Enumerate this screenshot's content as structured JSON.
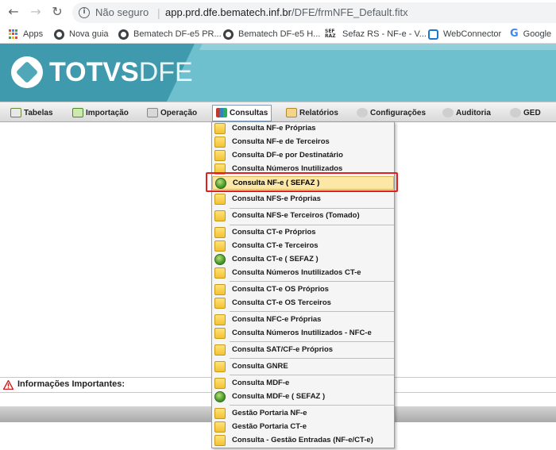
{
  "browser": {
    "back": "←",
    "forward": "→",
    "reload": "↻",
    "security_label": "Não seguro",
    "separator": "|",
    "url_host": "app.prd.dfe.bematech.inf.br",
    "url_path": "/DFE/frmNFE_Default.fitx",
    "bookmarks": [
      {
        "label": "Apps",
        "icon": "apps-icon"
      },
      {
        "label": "Nova guia",
        "icon": "globe-icon"
      },
      {
        "label": "Bematech DF-e5 PR...",
        "icon": "globe-icon"
      },
      {
        "label": "Bematech DF-e5 H...",
        "icon": "globe-icon"
      },
      {
        "label": "Sefaz RS - NF-e - V...",
        "icon": "sefaz-icon"
      },
      {
        "label": "WebConnector",
        "icon": "webconnector-icon"
      },
      {
        "label": "Google",
        "icon": "google-icon"
      }
    ]
  },
  "app": {
    "brand_a": "TOTVS",
    "brand_b": "DFE",
    "brand_color": "#4fa7b8"
  },
  "menu": [
    {
      "label": "Tabelas",
      "icon": "table-icon",
      "active": false
    },
    {
      "label": "Importação",
      "icon": "import-icon",
      "active": false
    },
    {
      "label": "Operação",
      "icon": "operation-icon",
      "active": false
    },
    {
      "label": "Consultas",
      "icon": "query-icon",
      "active": true
    },
    {
      "label": "Relatórios",
      "icon": "report-icon",
      "active": false
    },
    {
      "label": "Configurações",
      "icon": "gear-icon",
      "active": false
    },
    {
      "label": "Auditoria",
      "icon": "gear-icon",
      "active": false
    },
    {
      "label": "GED",
      "icon": "gear-icon",
      "active": false
    }
  ],
  "dropdown": {
    "items": [
      {
        "label": "Consulta NF-e Próprias",
        "icon": "folder"
      },
      {
        "label": "Consulta NF-e de Terceiros",
        "icon": "folder"
      },
      {
        "label": "Consulta DF-e por Destinatário",
        "icon": "folder"
      },
      {
        "label": "Consulta Números Inutilizados",
        "icon": "folder"
      },
      {
        "label": "Consulta NF-e ( SEFAZ )",
        "icon": "globe",
        "highlighted": true
      },
      {
        "label": "Consulta NFS-e Próprias",
        "icon": "folder"
      },
      {
        "label": "Consulta NFS-e Terceiros (Tomado)",
        "icon": "folder"
      },
      {
        "label": "Consulta CT-e Próprios",
        "icon": "folder"
      },
      {
        "label": "Consulta CT-e Terceiros",
        "icon": "folder"
      },
      {
        "label": "Consulta CT-e ( SEFAZ )",
        "icon": "globe"
      },
      {
        "label": "Consulta Números Inutilizados CT-e",
        "icon": "folder"
      },
      {
        "label": "Consulta CT-e OS Próprios",
        "icon": "folder"
      },
      {
        "label": "Consulta CT-e OS Terceiros",
        "icon": "folder"
      },
      {
        "label": "Consulta NFC-e Próprias",
        "icon": "folder"
      },
      {
        "label": "Consulta Números Inutilizados - NFC-e",
        "icon": "folder"
      },
      {
        "label": "Consulta SAT/CF-e Próprios",
        "icon": "folder"
      },
      {
        "label": "Consulta GNRE",
        "icon": "folder"
      },
      {
        "label": "Consulta MDF-e",
        "icon": "folder"
      },
      {
        "label": "Consulta MDF-e ( SEFAZ )",
        "icon": "globe"
      },
      {
        "label": "Gestão Portaria NF-e",
        "icon": "folder"
      },
      {
        "label": "Gestão Portaria CT-e",
        "icon": "folder"
      },
      {
        "label": "Consulta - Gestão Entradas (NF-e/CT-e)",
        "icon": "folder"
      }
    ]
  },
  "info": {
    "label": "Informações Importantes:"
  }
}
